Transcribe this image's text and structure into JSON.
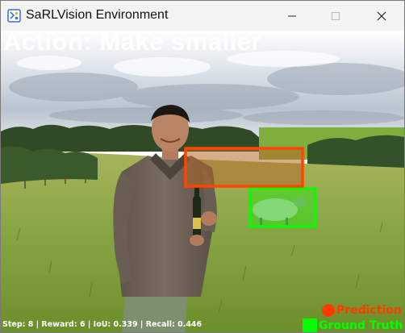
{
  "window": {
    "title": "SaRLVision Environment",
    "icon": "python-icon",
    "controls": [
      "minimize-icon",
      "maximize-icon",
      "close-icon"
    ]
  },
  "overlay": {
    "action_text": "Action: Make smaller",
    "status_text": "Step: 8 | Reward: 6 | IoU: 0.339 | Recall: 0.446"
  },
  "legend": {
    "prediction_label": "Prediction",
    "ground_truth_label": "Ground Truth",
    "prediction_color": "#ff3b00",
    "ground_truth_color": "#00ff00"
  }
}
